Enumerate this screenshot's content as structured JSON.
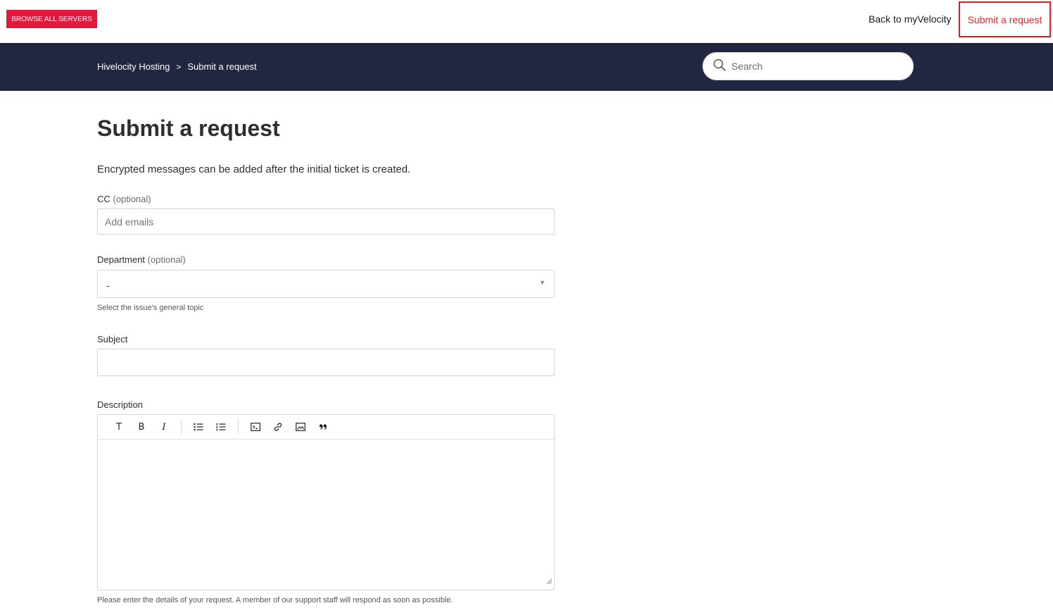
{
  "topbar": {
    "browse_label": "BROWSE ALL SERVERS",
    "back_link": "Back to myVelocity",
    "submit_link": "Submit a request"
  },
  "breadcrumb": {
    "home": "Hivelocity Hosting",
    "separator": ">",
    "current": "Submit a request"
  },
  "search": {
    "placeholder": "Search"
  },
  "page": {
    "title": "Submit a request",
    "intro": "Encrypted messages can be added after the initial ticket is created."
  },
  "form": {
    "cc": {
      "label": "CC",
      "optional": "(optional)",
      "placeholder": "Add emails"
    },
    "department": {
      "label": "Department",
      "optional": "(optional)",
      "value": "-",
      "hint": "Select the issue's general topic"
    },
    "subject": {
      "label": "Subject",
      "value": ""
    },
    "description": {
      "label": "Description",
      "hint": "Please enter the details of your request. A member of our support staff will respond as soon as possible.",
      "toolbar": [
        {
          "icon": "text-format-icon",
          "glyph": "T"
        },
        {
          "icon": "bold-icon",
          "glyph": "B"
        },
        {
          "icon": "italic-icon",
          "glyph": "I"
        },
        {
          "icon": "bullet-list-icon"
        },
        {
          "icon": "numbered-list-icon"
        },
        {
          "icon": "code-block-icon"
        },
        {
          "icon": "link-icon"
        },
        {
          "icon": "image-icon"
        },
        {
          "icon": "quote-icon"
        }
      ]
    }
  },
  "colors": {
    "brand_red": "#e6173d",
    "nav_band": "#232641",
    "highlight_border": "#e01c1c"
  }
}
